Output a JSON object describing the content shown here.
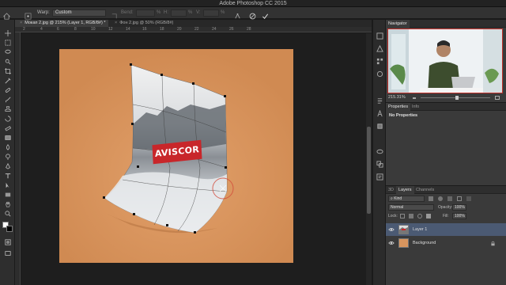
{
  "app": {
    "title": "Adobe Photoshop CC 2015"
  },
  "options_bar": {
    "warp_label": "Warp:",
    "warp_value": "Custom",
    "bend_label": "Bend:",
    "bend_value": "",
    "pct1": "%",
    "h_label": "H:",
    "pct2": "%",
    "v_label": "V:",
    "pct3": "%",
    "cancel_icon": "cancel-icon",
    "commit_icon": "check-icon"
  },
  "tabs": [
    {
      "label": "Мокап 2.jpg @ 215% (Layer 1, RGB/8#) *",
      "active": true
    },
    {
      "label": "Фон 2.jpg @ 50% (RGB/8#)",
      "active": false
    }
  ],
  "ruler": {
    "ticks": [
      "2",
      "4",
      "6",
      "8",
      "10",
      "12",
      "14",
      "16",
      "18",
      "20",
      "22",
      "24",
      "26",
      "28"
    ]
  },
  "poster": {
    "text": "AVISCOR"
  },
  "navigator": {
    "tab": "Navigator",
    "zoom": "215.31%"
  },
  "properties": {
    "tabs": [
      "Properties",
      "Info"
    ],
    "empty_text": "No Properties"
  },
  "layers_panel": {
    "tabs": [
      "3D",
      "Layers",
      "Channels"
    ],
    "kind_label": "Kind",
    "blend_mode": "Normal",
    "opacity_label": "Opacity:",
    "opacity_value": "100%",
    "lock_label": "Lock:",
    "fill_label": "Fill:",
    "fill_value": "100%",
    "layers": [
      {
        "name": "Layer 1",
        "selected": true
      },
      {
        "name": "Background",
        "selected": false
      }
    ]
  },
  "colors": {
    "canvas_bg": "#d8955e",
    "selection": "#4b5a73",
    "poster_red": "#c8262a"
  }
}
